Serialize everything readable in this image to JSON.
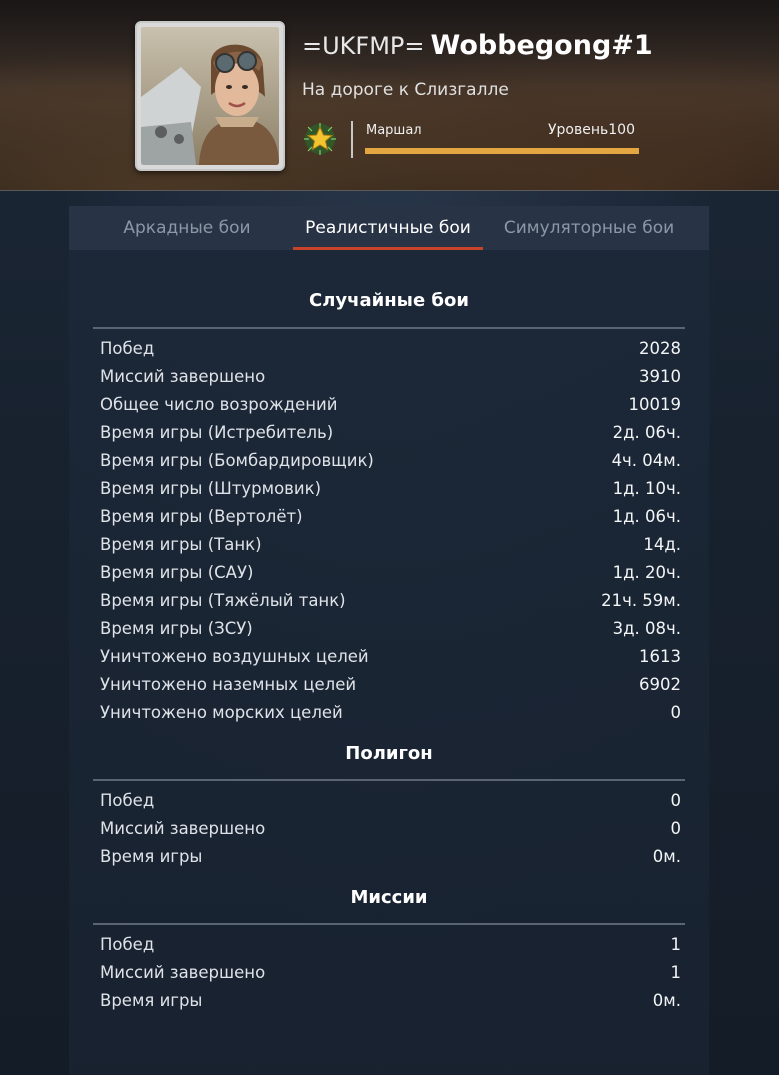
{
  "profile": {
    "clan_tag": "=UKFMP=",
    "nickname": "Wobbegong#1",
    "title": "На дороге к Слизгалле",
    "rank_name": "Маршал",
    "level_label": "Уровень",
    "level_value": "100",
    "level_progress": 1.0,
    "accent_color": "#e3a640"
  },
  "tabs": [
    {
      "label": "Аркадные бои",
      "active": false
    },
    {
      "label": "Реалистичные бои",
      "active": true
    },
    {
      "label": "Симуляторные бои",
      "active": false
    }
  ],
  "sections": [
    {
      "title": "Случайные бои",
      "rows": [
        {
          "label": "Побед",
          "value": "2028"
        },
        {
          "label": "Миссий завершено",
          "value": "3910"
        },
        {
          "label": "Общее число возрождений",
          "value": "10019"
        },
        {
          "label": "Время игры (Истребитель)",
          "value": "2д. 06ч."
        },
        {
          "label": "Время игры (Бомбардировщик)",
          "value": "4ч. 04м."
        },
        {
          "label": "Время игры (Штурмовик)",
          "value": "1д. 10ч."
        },
        {
          "label": "Время игры (Вертолёт)",
          "value": "1д. 06ч."
        },
        {
          "label": "Время игры (Танк)",
          "value": "14д."
        },
        {
          "label": "Время игры (САУ)",
          "value": "1д. 20ч."
        },
        {
          "label": "Время игры (Тяжёлый танк)",
          "value": "21ч. 59м."
        },
        {
          "label": "Время игры (ЗСУ)",
          "value": "3д. 08ч."
        },
        {
          "label": "Уничтожено воздушных целей",
          "value": "1613"
        },
        {
          "label": "Уничтожено наземных целей",
          "value": "6902"
        },
        {
          "label": "Уничтожено морских целей",
          "value": "0"
        }
      ]
    },
    {
      "title": "Полигон",
      "rows": [
        {
          "label": "Побед",
          "value": "0"
        },
        {
          "label": "Миссий завершено",
          "value": "0"
        },
        {
          "label": "Время игры",
          "value": "0м."
        }
      ]
    },
    {
      "title": "Миссии",
      "rows": [
        {
          "label": "Побед",
          "value": "1"
        },
        {
          "label": "Миссий завершено",
          "value": "1"
        },
        {
          "label": "Время игры",
          "value": "0м."
        }
      ]
    }
  ]
}
